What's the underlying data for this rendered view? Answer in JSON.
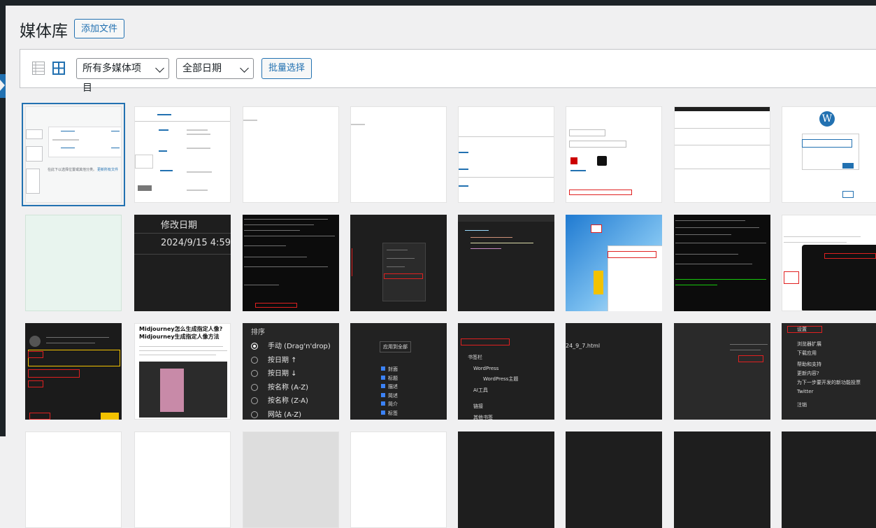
{
  "page": {
    "title": "媒体库",
    "add_button": "添加文件"
  },
  "toolbar": {
    "filter_type": "所有多媒体项目",
    "filter_date": "全部日期",
    "bulk_select": "批量选择"
  },
  "tiles": {
    "r1c1_text": "在此下以选择位置或其他分类。",
    "r1c1_link": "更新所有文件",
    "r2c2_label": "修改日期",
    "r2c2_date": "2024/9/15 4:59",
    "r3c2_title": "Midjourney怎么生成指定人像?Midjourney生成指定人像方法",
    "r3c3_header": "排序",
    "r3c3_options": [
      "手动 (Drag'n'drop)",
      "按日期 ↑",
      "按日期 ↓",
      "按名称 (A-Z)",
      "按名称 (Z-A)",
      "网站 (A-Z)"
    ],
    "r3c4_button": "应用到全部",
    "r3c4_items": [
      "封面",
      "标题",
      "描述",
      "简述",
      "简介",
      "标签"
    ],
    "r3c5_items": [
      "书签栏",
      "WordPress",
      "WordPress主题",
      "AI工具",
      "链接",
      "其他书签"
    ],
    "r3c6_file": "24_9_7.html",
    "r3c8_items": [
      "设置",
      "浏览器扩展",
      "下载应用",
      "帮助和支持",
      "更新内容?",
      "为下一步要开发的新功能投票",
      "Twitter",
      "注销"
    ]
  },
  "colors": {
    "accent": "#2271b1",
    "admin_bar": "#1d2327",
    "page_bg": "#f0f0f1",
    "annotation_red": "#e02020"
  },
  "icons": {
    "list_view": "list-view-icon",
    "grid_view": "grid-view-icon",
    "chevron": "chevron-down-icon"
  }
}
